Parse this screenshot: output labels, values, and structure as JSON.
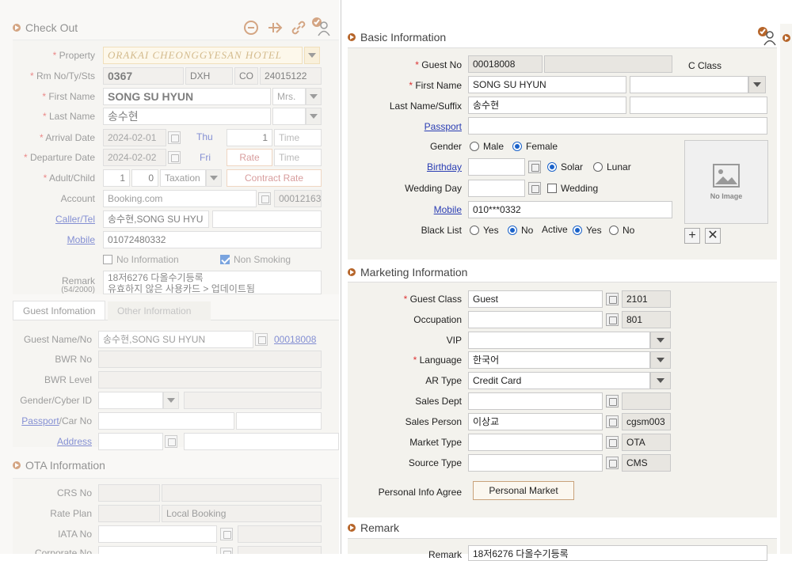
{
  "left": {
    "title": "Check Out",
    "property_label": "Property",
    "property_value": "ORAKAI CHEONGGYESAN HOTEL",
    "rm_label": "Rm No/Ty/Sts",
    "rm_no": "0367",
    "rm_type": "DXH",
    "rm_status": "CO",
    "rm_extra": "24015122",
    "first_name_label": "First Name",
    "first_name": "SONG SU HYUN",
    "title_value": "Mrs.",
    "last_name_label": "Last Name",
    "last_name": "송수현",
    "arrival_label": "Arrival Date",
    "arrival_date": "2024-02-01",
    "arrival_day": "Thu",
    "nights": "1",
    "time_placeholder": "Time",
    "departure_label": "Departure Date",
    "departure_date": "2024-02-02",
    "departure_day": "Fri",
    "rate_label": "Rate",
    "time2_placeholder": "Time",
    "adult_label": "Adult/Child",
    "adult": "1",
    "child": "0",
    "taxation": "Taxation",
    "contract_rate": "Contract Rate",
    "account_label": "Account",
    "account_value": "Booking.com",
    "account_code": "00012163",
    "caller_label": "Caller/Tel",
    "caller_value": "송수현,SONG SU HYU",
    "mobile_label": "Mobile",
    "mobile_value": "01072480332",
    "no_info": "No Information",
    "non_smoking": "Non Smoking",
    "remark_label": "Remark",
    "remark_count": "(54/2000)",
    "remark_line1": "18저6276 다올수기등록",
    "remark_line2": "유효하지 않은 사용카드 > 업데이트됨",
    "tab_guest": "Guest Infomation",
    "tab_other": "Other Information",
    "guest_name_label": "Guest Name/No",
    "guest_name_value": "송수현,SONG SU HYUN",
    "guest_no": "00018008",
    "bwr_no_label": "BWR No",
    "bwr_level_label": "BWR Level",
    "gender_cyber_label": "Gender/Cyber ID",
    "passport_car_label_link": "Passport",
    "passport_car_label_rest": "/Car No",
    "address_label": "Address",
    "ota_title": "OTA Information",
    "crs_label": "CRS No",
    "rate_plan_label": "Rate Plan",
    "rate_plan_value": "Local Booking",
    "iata_label": "IATA No",
    "corporate_label": "Corporate No"
  },
  "basic": {
    "title": "Basic Information",
    "guest_no_label": "Guest No",
    "guest_no": "00018008",
    "class_value": "C Class",
    "first_name_label": "First Name",
    "first_name": "SONG SU HYUN",
    "last_name_label": "Last Name/Suffix",
    "last_name": "송수현",
    "passport_label": "Passport",
    "gender_label": "Gender",
    "male": "Male",
    "female": "Female",
    "birthday_label": "Birthday",
    "solar": "Solar",
    "lunar": "Lunar",
    "wedding_day_label": "Wedding Day",
    "wedding": "Wedding",
    "mobile_label": "Mobile",
    "mobile": "010***0332",
    "black_list_label": "Black List",
    "yes": "Yes",
    "no": "No",
    "active_label": "Active",
    "active_yes": "Yes",
    "active_no": "No",
    "no_image": "No Image"
  },
  "marketing": {
    "title": "Marketing Information",
    "guest_class_label": "Guest Class",
    "guest_class": "Guest",
    "guest_class_code": "2101",
    "occupation_label": "Occupation",
    "occupation_code": "801",
    "vip_label": "VIP",
    "language_label": "Language",
    "language": "한국어",
    "ar_type_label": "AR Type",
    "ar_type": "Credit Card",
    "sales_dept_label": "Sales Dept",
    "sales_person_label": "Sales Person",
    "sales_person": "이상교",
    "sales_person_code": "cgsm003",
    "market_type_label": "Market Type",
    "market_type_code": "OTA",
    "source_type_label": "Source Type",
    "source_type_code": "CMS",
    "personal_info_label": "Personal Info Agree",
    "personal_market_button": "Personal Market"
  },
  "remark": {
    "title": "Remark",
    "label": "Remark",
    "value": "18저6276 다올수기등록"
  },
  "colors": {
    "accent_dot": "#b6652a",
    "link": "#2a3db3",
    "required": "#dd3333",
    "radio_on": "#1a62c9"
  }
}
